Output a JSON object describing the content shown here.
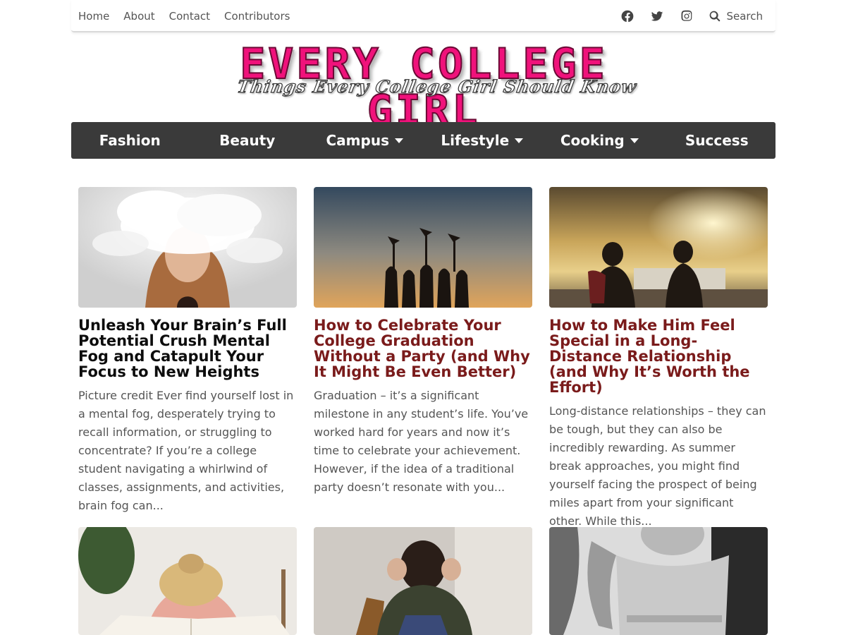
{
  "topnav": {
    "items": [
      "Home",
      "About",
      "Contact",
      "Contributors"
    ],
    "social": [
      "facebook-icon",
      "twitter-icon",
      "instagram-icon"
    ],
    "search_label": "Search"
  },
  "logo": {
    "title": "EVERY COLLEGE GIRL",
    "tagline": "Things Every College Girl Should Know"
  },
  "mainnav": {
    "items": [
      {
        "label": "Fashion",
        "dropdown": false
      },
      {
        "label": "Beauty",
        "dropdown": false
      },
      {
        "label": "Campus",
        "dropdown": true
      },
      {
        "label": "Lifestyle",
        "dropdown": true
      },
      {
        "label": "Cooking",
        "dropdown": true
      },
      {
        "label": "Success",
        "dropdown": false
      }
    ]
  },
  "articles": [
    {
      "title": "Unleash Your Brain’s Full Potential Crush Mental Fog and Catapult Your Focus to New Heights",
      "excerpt": "Picture credit Ever find yourself lost in a mental fog, desperately trying to recall information, or struggling to concentrate? If you’re a college student navigating a whirlwind of classes, assignments, and activities, brain fog can..."
    },
    {
      "title": "How to Celebrate Your College Graduation Without a Party (and Why It Might Be Even Better)",
      "excerpt": "Graduation – it’s a significant milestone in any student’s life. You’ve worked hard for years and now it’s time to celebrate your achievement. However, if the idea of a traditional party doesn’t resonate with you..."
    },
    {
      "title": "How to Make Him Feel Special in a Long-Distance Relationship (and Why It’s Worth the Effort)",
      "excerpt": "Long-distance relationships – they can be tough, but they can also be incredibly rewarding. As summer break approaches, you might find yourself facing the prospect of being miles apart from your significant other. While this..."
    }
  ],
  "colors": {
    "nav_bg": "#3a3a3a",
    "logo_pink": "#f0127b",
    "title_dark": "#0d0d0d",
    "text_gray": "#555555"
  }
}
